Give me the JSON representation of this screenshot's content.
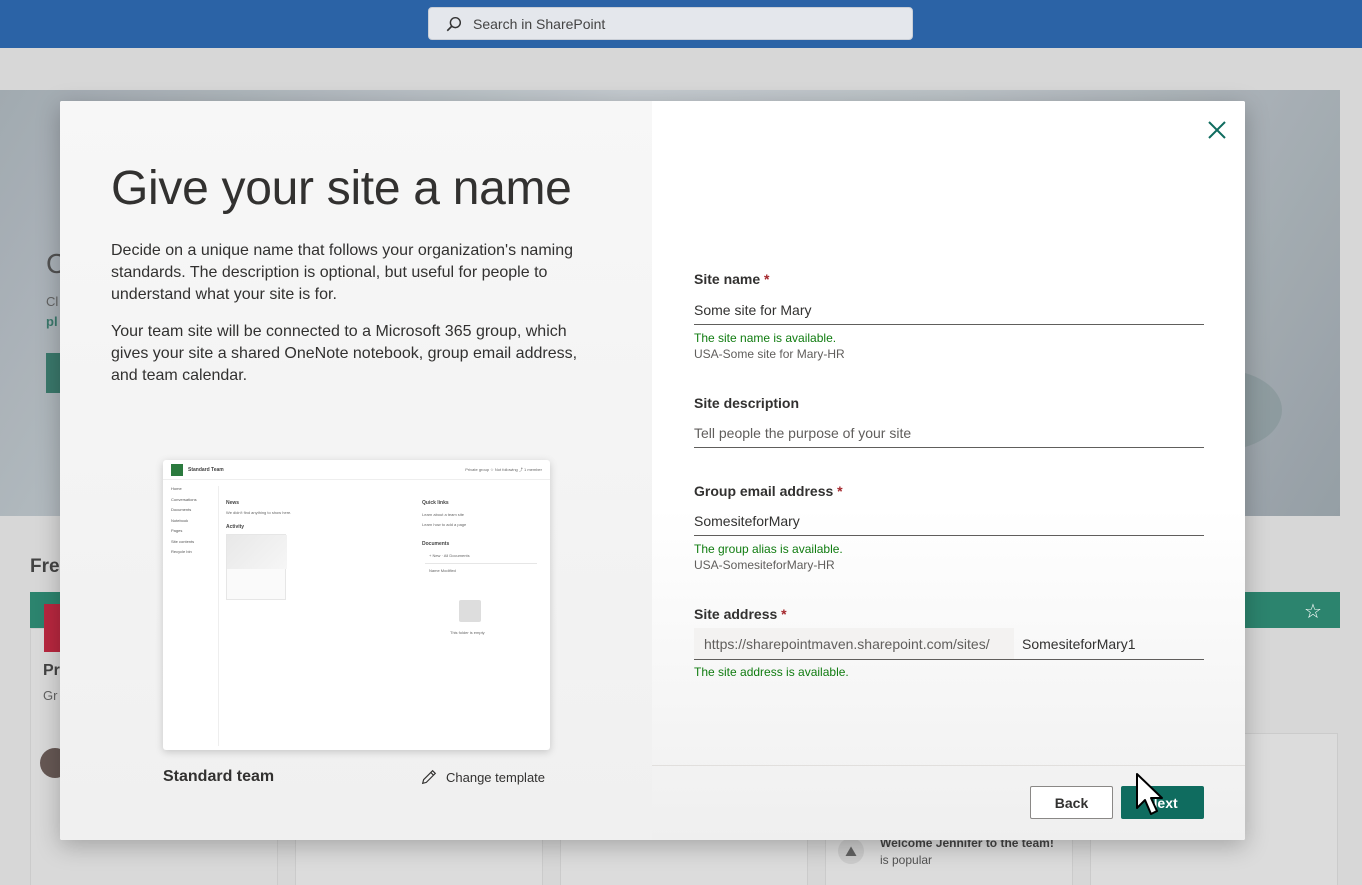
{
  "suite_bar": {
    "search_placeholder": "Search in SharePoint"
  },
  "background": {
    "section_title_fragment": "Fre",
    "hero_title_fragment": "C",
    "hero_text_line1": "Cl",
    "hero_text_line2": "pl",
    "card_title_fragment": "Pr",
    "card_subtitle_fragment": "Gr",
    "news_title": "Welcome Jennifer to the team!",
    "news_sub": "is popular"
  },
  "modal": {
    "title": "Give your site a name",
    "paragraph1": "Decide on a unique name that follows your organization's naming standards. The description is optional, but useful for people to understand what your site is for.",
    "paragraph2": "Your team site will be connected to a Microsoft 365 group, which gives your site a shared OneNote notebook, group email address, and team calendar.",
    "template": {
      "name": "Standard team",
      "change_label": "Change template",
      "preview": {
        "site_title": "Standard Team",
        "header_right": "Private group   ☆ Not following   ⤴ 1 member",
        "nav": [
          "Home",
          "Conversations",
          "Documents",
          "Notebook",
          "Pages",
          "Site contents",
          "Recycle bin"
        ],
        "news_heading": "News",
        "news_text": "We didn't find anything to show here.",
        "activity_heading": "Activity",
        "quick_links_heading": "Quick links",
        "quick_links": [
          "Learn about a team site",
          "Learn how to add a page"
        ],
        "documents_heading": "Documents",
        "documents_toolbar": "+ New   ·   All Documents",
        "documents_columns": "Name        Modified",
        "empty_text": "This folder is empty"
      }
    },
    "form": {
      "site_name": {
        "label": "Site name",
        "required_mark": "*",
        "value": "Some site for Mary",
        "status": "The site name is available.",
        "hint": "USA-Some site for Mary-HR"
      },
      "site_description": {
        "label": "Site description",
        "placeholder": "Tell people the purpose of your site",
        "value": ""
      },
      "group_email": {
        "label": "Group email address",
        "required_mark": "*",
        "value": "SomesiteforMary",
        "status": "The group alias is available.",
        "hint": "USA-SomesiteforMary-HR"
      },
      "site_address": {
        "label": "Site address",
        "required_mark": "*",
        "prefix": "https://sharepointmaven.sharepoint.com/sites/",
        "value": "SomesiteforMary1",
        "status": "The site address is available."
      }
    },
    "buttons": {
      "back": "Back",
      "next": "Next"
    }
  },
  "colors": {
    "suite_bar": "#2b63a6",
    "primary": "#0f6c5f",
    "success": "#107c10",
    "required": "#a4262c"
  }
}
